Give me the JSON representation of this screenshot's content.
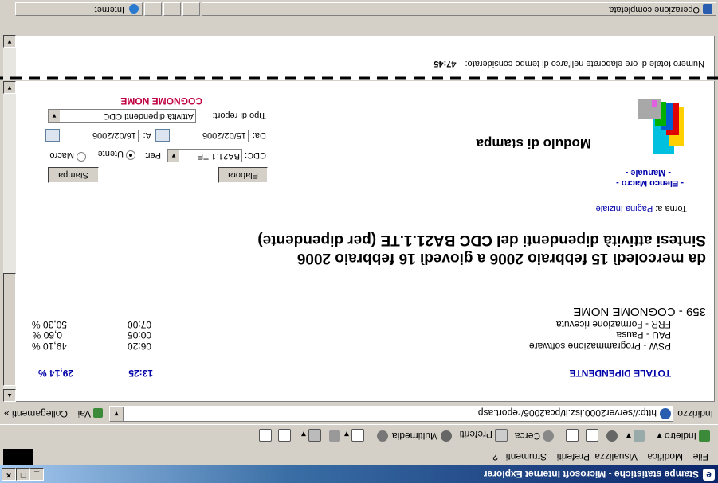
{
  "window": {
    "title": "Stampe statistiche - Microsoft Internet Explorer"
  },
  "menu": {
    "items": [
      "File",
      "Modifica",
      "Visualizza",
      "Preferiti",
      "Strumenti",
      "?"
    ]
  },
  "toolbar": {
    "back": "Indietro",
    "search": "Cerca",
    "favorites": "Preferiti",
    "media": "Multimedia"
  },
  "address": {
    "label": "Indirizzo",
    "url": "http://server2000.isz.it/pca2006/report.asp",
    "go": "Vai",
    "links": "Collegamenti"
  },
  "page": {
    "error": "COGNOME NOME",
    "report_type_label": "Tipo di report:",
    "report_type_value": "Attività dipendenti CDC",
    "from_label": "Da:",
    "from_value": "15/02/2006",
    "to_label": "A:",
    "to_value": "16/02/2006",
    "cdc_label": "CDC:",
    "cdc_value": "BA21.1.TE",
    "per_label": "Per:",
    "radio_user": "Utente",
    "radio_macro": "Macro",
    "elabora": "Elabora",
    "stampa": "Stampa",
    "module_title": "Modulo di stampa",
    "manuale": "- Manuale -",
    "elenco_macro": "- Elenco Macro -",
    "back_text": "Torna a:",
    "back_link": "Pagina Iniziale",
    "report_title": "Sintesi attività dipendenti del CDC BA21.1.TE (per dipendente)",
    "report_period": "da mercoledì 15 febbraio 2006 a giovedì 16 febbraio 2006",
    "employee": "359 - COGNOME NOME",
    "rows": [
      {
        "activity": "FRR - Formazione ricevuta",
        "time": "07:00",
        "pct": "50,30 %"
      },
      {
        "activity": "PAU - Pausa",
        "time": "00:05",
        "pct": "0,60 %"
      },
      {
        "activity": "PSW - Programmazione software",
        "time": "06:20",
        "pct": "49,10 %"
      }
    ],
    "total_label": "TOTALE DIPENDENTE",
    "total_time": "13:25",
    "total_pct": "29,14 %",
    "summary_label": "Numero totale di ore elaborate nell'arco di tempo considerato:",
    "summary_value": "47:45"
  },
  "status": {
    "text": "Operazione completata",
    "zone": "Internet"
  }
}
